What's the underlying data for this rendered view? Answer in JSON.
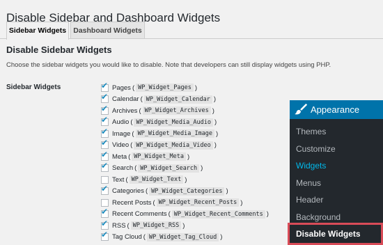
{
  "page_title": "Disable Sidebar and Dashboard Widgets",
  "tabs": [
    {
      "label": "Sidebar Widgets",
      "active": true
    },
    {
      "label": "Dashboard Widgets",
      "active": false
    }
  ],
  "section": {
    "title": "Disable Sidebar Widgets",
    "description": "Choose the sidebar widgets you would like to disable. Note that developers can still display widgets using PHP."
  },
  "field_label": "Sidebar Widgets",
  "widgets": [
    {
      "name": "Pages",
      "class": "WP_Widget_Pages",
      "checked": true
    },
    {
      "name": "Calendar",
      "class": "WP_Widget_Calendar",
      "checked": true
    },
    {
      "name": "Archives",
      "class": "WP_Widget_Archives",
      "checked": true
    },
    {
      "name": "Audio",
      "class": "WP_Widget_Media_Audio",
      "checked": true
    },
    {
      "name": "Image",
      "class": "WP_Widget_Media_Image",
      "checked": true
    },
    {
      "name": "Video",
      "class": "WP_Widget_Media_Video",
      "checked": true
    },
    {
      "name": "Meta",
      "class": "WP_Widget_Meta",
      "checked": true
    },
    {
      "name": "Search",
      "class": "WP_Widget_Search",
      "checked": true
    },
    {
      "name": "Text",
      "class": "WP_Widget_Text",
      "checked": false
    },
    {
      "name": "Categories",
      "class": "WP_Widget_Categories",
      "checked": true
    },
    {
      "name": "Recent Posts",
      "class": "WP_Widget_Recent_Posts",
      "checked": false
    },
    {
      "name": "Recent Comments",
      "class": "WP_Widget_Recent_Comments",
      "checked": true
    },
    {
      "name": "RSS",
      "class": "WP_Widget_RSS",
      "checked": true
    },
    {
      "name": "Tag Cloud",
      "class": "WP_Widget_Tag_Cloud",
      "checked": true
    }
  ],
  "admin_menu": {
    "section_label": "Appearance",
    "section_icon": "paintbrush-icon",
    "items": [
      {
        "label": "Themes",
        "current": false
      },
      {
        "label": "Customize",
        "current": false
      },
      {
        "label": "Widgets",
        "current": true
      },
      {
        "label": "Menus",
        "current": false
      },
      {
        "label": "Header",
        "current": false
      },
      {
        "label": "Background",
        "current": false
      }
    ],
    "highlighted_item": "Disable Widgets"
  },
  "colors": {
    "accent": "#0073aa",
    "checkbox_tick": "#1e8cbe",
    "current_menu_item": "#00b9eb",
    "highlight_border": "#d94c58",
    "menu_background": "#23282d"
  }
}
